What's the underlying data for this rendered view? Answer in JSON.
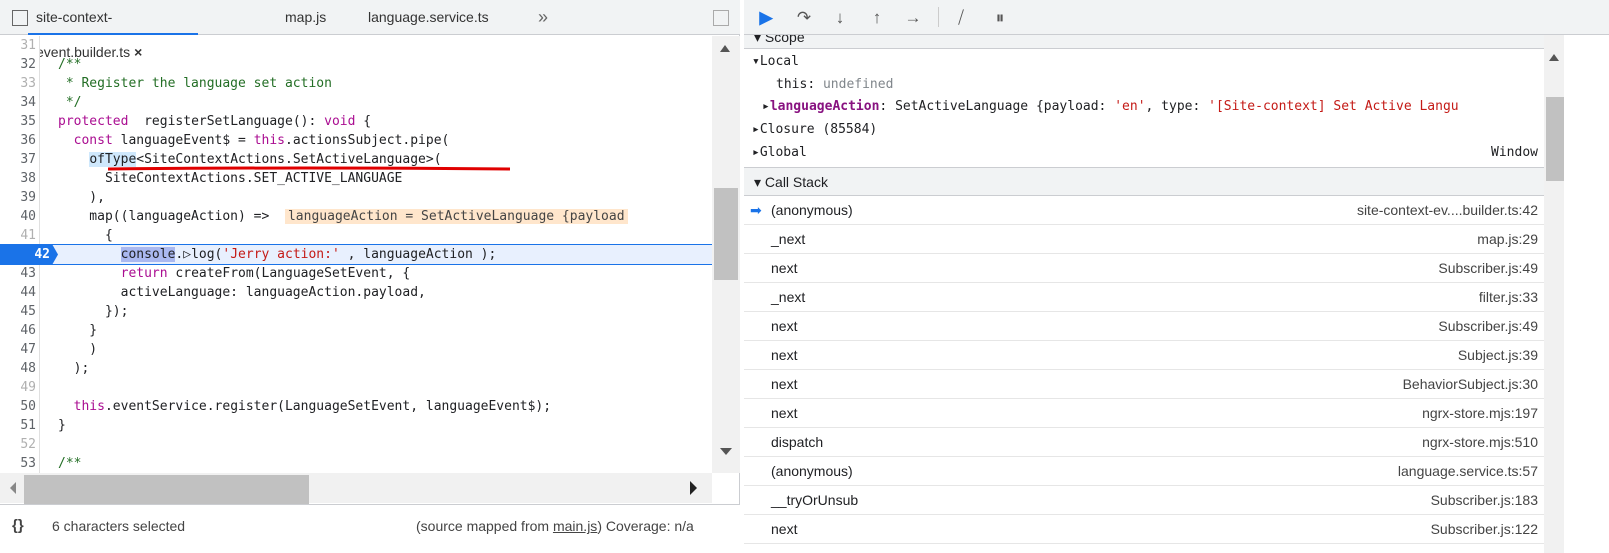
{
  "tabs": [
    {
      "label": "site-context-event.builder.ts",
      "active": true,
      "close": "×"
    },
    {
      "label": "map.js"
    },
    {
      "label": "language.service.ts"
    }
  ],
  "tabs_more": "»",
  "code": {
    "lines": [
      {
        "n": "31",
        "dim": true,
        "segs": []
      },
      {
        "n": "32",
        "segs": [
          [
            "c",
            "/**"
          ]
        ]
      },
      {
        "n": "33",
        "dim": true,
        "segs": [
          [
            "c",
            " * Register the language set action"
          ]
        ]
      },
      {
        "n": "34",
        "segs": [
          [
            "c",
            " */"
          ]
        ]
      },
      {
        "n": "35",
        "segs": [
          [
            "k",
            "protected"
          ],
          [
            "",
            "  registerSetLanguage(): "
          ],
          [
            "k",
            "void"
          ],
          [
            "",
            " {"
          ]
        ]
      },
      {
        "n": "36",
        "segs": [
          [
            "",
            "  "
          ],
          [
            "k",
            "const"
          ],
          [
            "",
            " languageEvent$ = "
          ],
          [
            "k",
            "this"
          ],
          [
            "",
            ".actionsSubject.pipe("
          ]
        ]
      },
      {
        "n": "37",
        "segs": [
          [
            "",
            "    "
          ],
          [
            "hl",
            "ofType"
          ],
          [
            "",
            "<SiteContextActions.SetActiveLanguage>("
          ]
        ]
      },
      {
        "n": "38",
        "segs": [
          [
            "",
            "      SiteContextActions.SET_ACTIVE_LANGUAGE"
          ]
        ]
      },
      {
        "n": "39",
        "segs": [
          [
            "",
            "    ),"
          ]
        ]
      },
      {
        "n": "40",
        "segs": [
          [
            "",
            "    map((languageAction) =>  "
          ],
          [
            "inline",
            "languageAction = SetActiveLanguage {payload"
          ]
        ]
      },
      {
        "n": "41",
        "dim": true,
        "segs": [
          [
            "",
            "      {"
          ]
        ]
      },
      {
        "n": "42",
        "bp": true,
        "segs": [
          [
            "",
            "        "
          ],
          [
            "sel",
            "console"
          ],
          [
            "",
            ".▷log("
          ],
          [
            "s",
            "'Jerry action:'"
          ],
          [
            "",
            " , languageAction );"
          ]
        ]
      },
      {
        "n": "43",
        "segs": [
          [
            "",
            "        "
          ],
          [
            "k",
            "return"
          ],
          [
            "",
            " createFrom(LanguageSetEvent, {"
          ]
        ]
      },
      {
        "n": "44",
        "segs": [
          [
            "",
            "        activeLanguage: languageAction.payload,"
          ]
        ]
      },
      {
        "n": "45",
        "segs": [
          [
            "",
            "      });"
          ]
        ]
      },
      {
        "n": "46",
        "segs": [
          [
            "",
            "    }"
          ]
        ]
      },
      {
        "n": "47",
        "segs": [
          [
            "",
            "    )"
          ]
        ]
      },
      {
        "n": "48",
        "segs": [
          [
            "",
            "  );"
          ]
        ]
      },
      {
        "n": "49",
        "dim": true,
        "segs": []
      },
      {
        "n": "50",
        "segs": [
          [
            "",
            "  "
          ],
          [
            "k",
            "this"
          ],
          [
            "",
            ".eventService.register(LanguageSetEvent, languageEvent$);"
          ]
        ]
      },
      {
        "n": "51",
        "segs": [
          [
            "",
            "}"
          ]
        ]
      },
      {
        "n": "52",
        "dim": true,
        "segs": []
      },
      {
        "n": "53",
        "segs": [
          [
            "c",
            "/**"
          ]
        ]
      }
    ]
  },
  "status": {
    "braces": "{}",
    "selection": "6 characters selected",
    "mapped_prefix": "(source mapped from ",
    "mapped_link": "main.js",
    "mapped_suffix": ")",
    "coverage": "Coverage: n/a"
  },
  "scope": {
    "title": "Scope",
    "local": "Local",
    "this_key": "this",
    "this_val": "undefined",
    "la_key": "languageAction",
    "la_class": "SetActiveLanguage {payload: ",
    "la_payload": "'en'",
    "la_mid": ", type: ",
    "la_type": "'[Site-context] Set Active Langu",
    "closure": "Closure (85584)",
    "global": "Global",
    "global_val": "Window"
  },
  "callstack": {
    "title": "Call Stack",
    "frames": [
      {
        "fn": "(anonymous)",
        "loc": "site-context-ev....builder.ts:42",
        "current": true
      },
      {
        "fn": "_next",
        "loc": "map.js:29"
      },
      {
        "fn": "next",
        "loc": "Subscriber.js:49"
      },
      {
        "fn": "_next",
        "loc": "filter.js:33"
      },
      {
        "fn": "next",
        "loc": "Subscriber.js:49"
      },
      {
        "fn": "next",
        "loc": "Subject.js:39"
      },
      {
        "fn": "next",
        "loc": "BehaviorSubject.js:30"
      },
      {
        "fn": "next",
        "loc": "ngrx-store.mjs:197"
      },
      {
        "fn": "dispatch",
        "loc": "ngrx-store.mjs:510"
      },
      {
        "fn": "(anonymous)",
        "loc": "language.service.ts:57"
      },
      {
        "fn": "__tryOrUnsub",
        "loc": "Subscriber.js:183"
      },
      {
        "fn": "next",
        "loc": "Subscriber.js:122"
      }
    ]
  },
  "colors": {
    "accent": "#1a73e8",
    "annotation": "#e00000"
  }
}
